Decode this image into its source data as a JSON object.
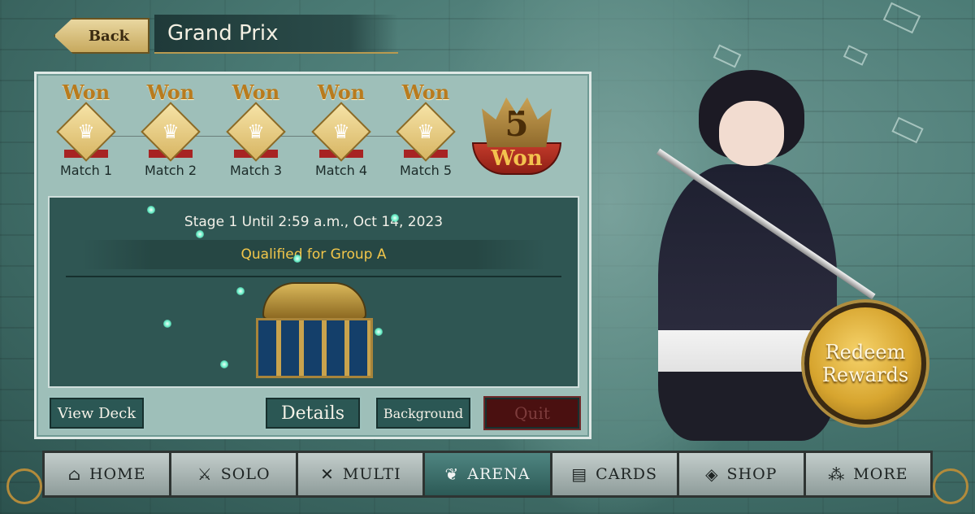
{
  "header": {
    "back_label": "Back",
    "title": "Grand Prix"
  },
  "matches": [
    {
      "result": "Won",
      "name": "Match 1"
    },
    {
      "result": "Won",
      "name": "Match 2"
    },
    {
      "result": "Won",
      "name": "Match 3"
    },
    {
      "result": "Won",
      "name": "Match 4"
    },
    {
      "result": "Won",
      "name": "Match 5"
    }
  ],
  "summary": {
    "wins": "5",
    "label": "Won"
  },
  "stage": {
    "text": "Stage 1 Until 2:59 a.m., Oct 14, 2023",
    "group": "Qualified for Group A"
  },
  "buttons": {
    "view_deck": "View Deck",
    "details": "Details",
    "background": "Background",
    "quit": "Quit"
  },
  "redeem": {
    "line1": "Redeem",
    "line2": "Rewards"
  },
  "nav": [
    {
      "label": "HOME",
      "icon": "home-icon"
    },
    {
      "label": "SOLO",
      "icon": "solo-sword-shield-icon"
    },
    {
      "label": "MULTI",
      "icon": "crossed-swords-icon"
    },
    {
      "label": "ARENA",
      "icon": "arena-laurel-icon",
      "active": true
    },
    {
      "label": "CARDS",
      "icon": "cards-icon"
    },
    {
      "label": "SHOP",
      "icon": "shop-icon"
    },
    {
      "label": "MORE",
      "icon": "more-icon"
    }
  ],
  "colors": {
    "accent_gold": "#d7a52f",
    "won_text": "#b87b1e",
    "group_text": "#f2c64a",
    "active_tab": "#2c5a56"
  }
}
